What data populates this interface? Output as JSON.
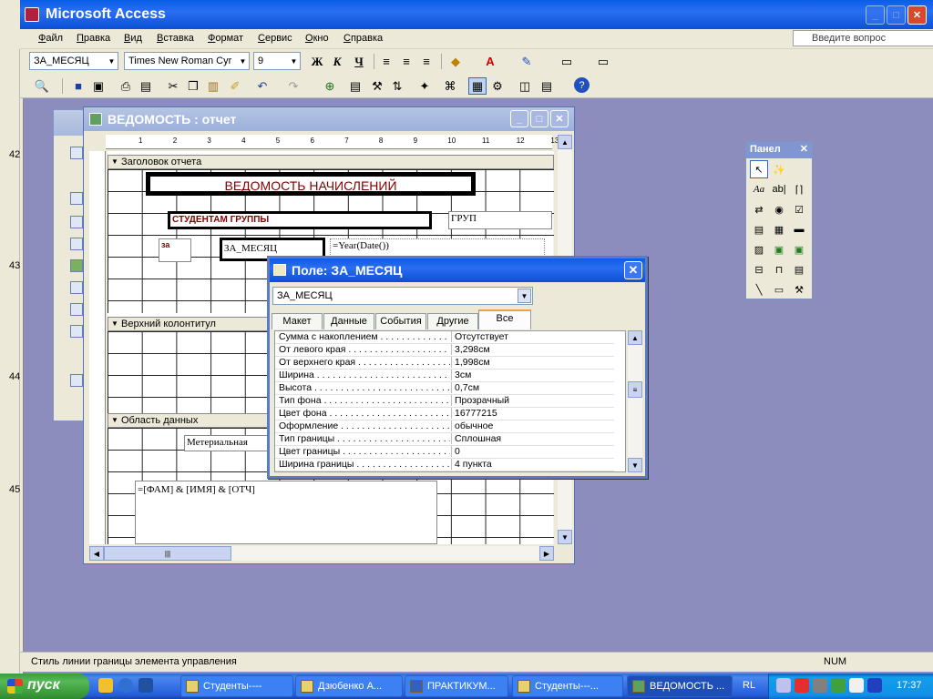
{
  "app": {
    "title": "Microsoft Access"
  },
  "menu": [
    "Файл",
    "Правка",
    "Вид",
    "Вставка",
    "Формат",
    "Сервис",
    "Окно",
    "Справка"
  ],
  "help_placeholder": "Введите вопрос",
  "formatting": {
    "control": "ЗА_МЕСЯЦ",
    "font": "Times New Roman Cyr",
    "size": "9",
    "bold": "Ж",
    "italic": "К",
    "underline": "Ч"
  },
  "gutter_labels": [
    "42",
    "43",
    "44",
    "45"
  ],
  "report": {
    "title": "ВЕДОМОСТЬ : отчет",
    "ruler": [
      "1",
      "2",
      "3",
      "4",
      "5",
      "6",
      "7",
      "8",
      "9",
      "10",
      "11",
      "12",
      "13"
    ],
    "sections": {
      "header": "Заголовок отчета",
      "page_header": "Верхний колонтитул",
      "detail": "Область данных"
    },
    "controls": {
      "title_label": "ВЕДОМОСТЬ НАЧИСЛЕНИЙ",
      "group_label": "СТУДЕНТАМ ГРУППЫ",
      "grup_field": "ГРУП",
      "za_label": "за",
      "month_field": "ЗА_МЕСЯЦ",
      "year_field": "=Year(Date())",
      "material_label": "Метериальная",
      "name_field": "=[ФАМ] & [ИМЯ] & [ОТЧ]"
    }
  },
  "toolbox": {
    "title": "Панел"
  },
  "properties": {
    "title": "Поле: ЗА_МЕСЯЦ",
    "selected": "ЗА_МЕСЯЦ",
    "tabs": [
      "Макет",
      "Данные",
      "События",
      "Другие",
      "Все"
    ],
    "active_tab": "Все",
    "rows": [
      {
        "name": "Сумма с накоплением",
        "value": "Отсутствует"
      },
      {
        "name": "От левого края",
        "value": "3,298см"
      },
      {
        "name": "От верхнего края",
        "value": "1,998см"
      },
      {
        "name": "Ширина",
        "value": "3см"
      },
      {
        "name": "Высота",
        "value": "0,7см"
      },
      {
        "name": "Тип фона",
        "value": "Прозрачный"
      },
      {
        "name": "Цвет фона",
        "value": "16777215"
      },
      {
        "name": "Оформление",
        "value": "обычное"
      },
      {
        "name": "Тип границы",
        "value": "Сплошная"
      },
      {
        "name": "Цвет границы",
        "value": "0"
      },
      {
        "name": "Ширина границы",
        "value": "4 пункта"
      }
    ]
  },
  "statusbar": {
    "text": "Стиль линии границы элемента управления",
    "num": "NUM"
  },
  "taskbar": {
    "start": "пуск",
    "tasks": [
      "Студенты----",
      "Дзюбенко А...",
      "ПРАКТИКУМ...",
      "Студенты---...",
      "ВЕДОМОСТЬ ..."
    ],
    "lang": "RL",
    "clock": "17:37"
  }
}
